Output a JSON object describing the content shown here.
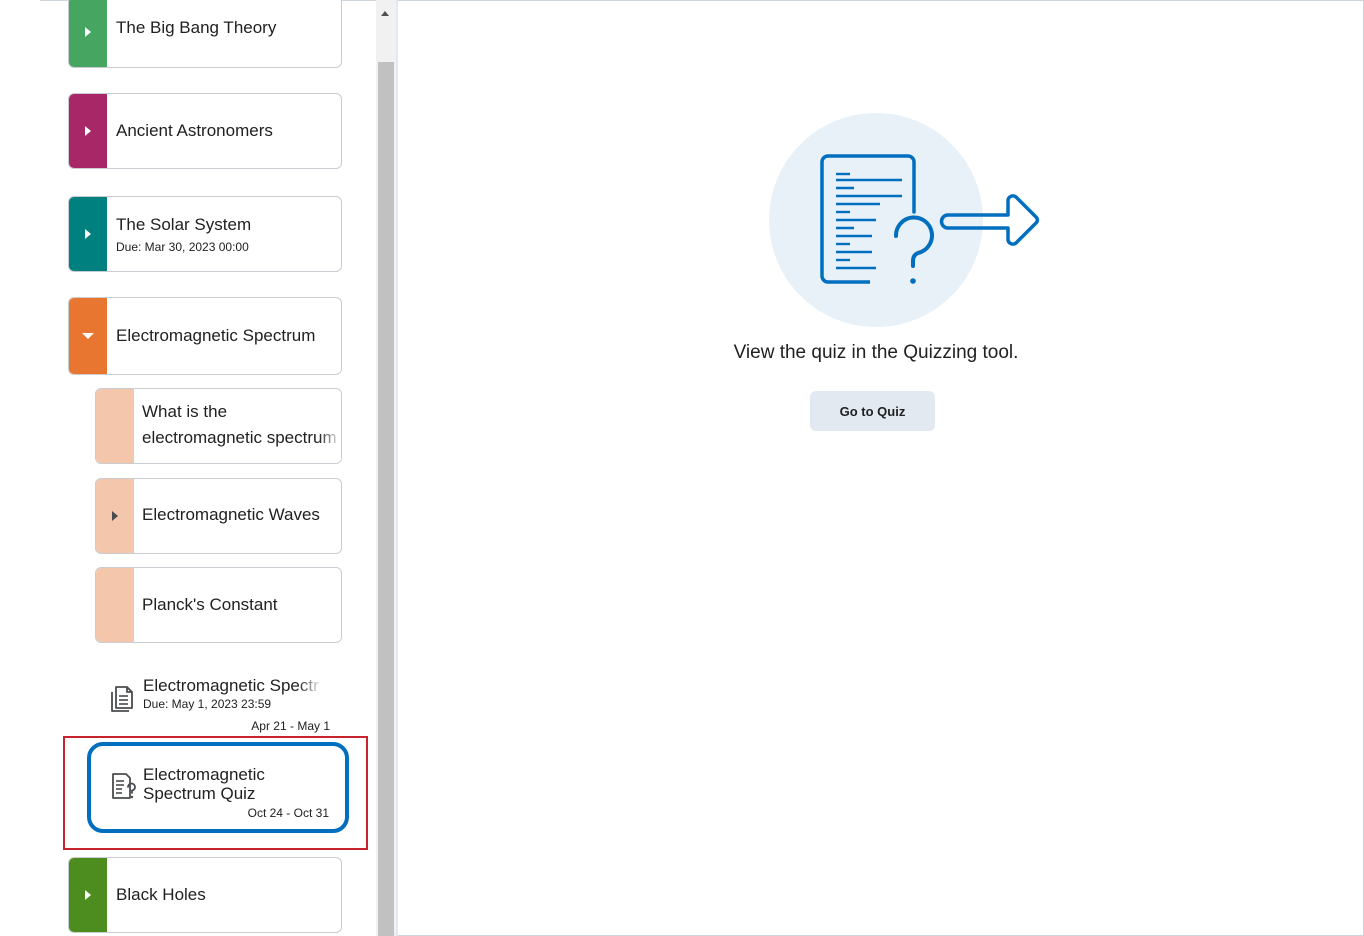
{
  "sidebar": {
    "modules": [
      {
        "title": "The Big Bang Theory",
        "color": "#46a661"
      },
      {
        "title": "Ancient Astronomers",
        "color": "#a82867"
      },
      {
        "title": "The Solar System",
        "due": "Due: Mar 30, 2023 00:00",
        "color": "#00807e"
      },
      {
        "title": "Electromagnetic Spectrum",
        "color": "#e87631",
        "expanded": true
      }
    ],
    "submodules": [
      {
        "title_line1": "What is the",
        "title_line2": "electromagnetic spectrum"
      },
      {
        "title": "Electromagnetic Waves"
      },
      {
        "title": "Planck's Constant"
      }
    ],
    "submodule_color": "#f4c7ad",
    "assignment": {
      "title": "Electromagnetic Spectr",
      "due": "Due: May 1, 2023 23:59",
      "range": "Apr 21 - May 1",
      "icon": "assignment-document-icon"
    },
    "quiz": {
      "title_line1": "Electromagnetic",
      "title_line2": "Spectrum Quiz",
      "range": "Oct 24 - Oct 31",
      "icon": "quiz-icon",
      "selected": true
    },
    "last_module": {
      "title": "Black Holes",
      "color": "#4d8c1f"
    }
  },
  "content": {
    "illustration": "quiz-document-arrow-icon",
    "message": "View the quiz in the Quizzing tool.",
    "button_label": "Go to Quiz"
  },
  "colors": {
    "selected_border": "#006fbf",
    "highlight_border": "#c6232f",
    "illustration_blue": "#006fbf",
    "illustration_bg": "#e8f1f8"
  }
}
